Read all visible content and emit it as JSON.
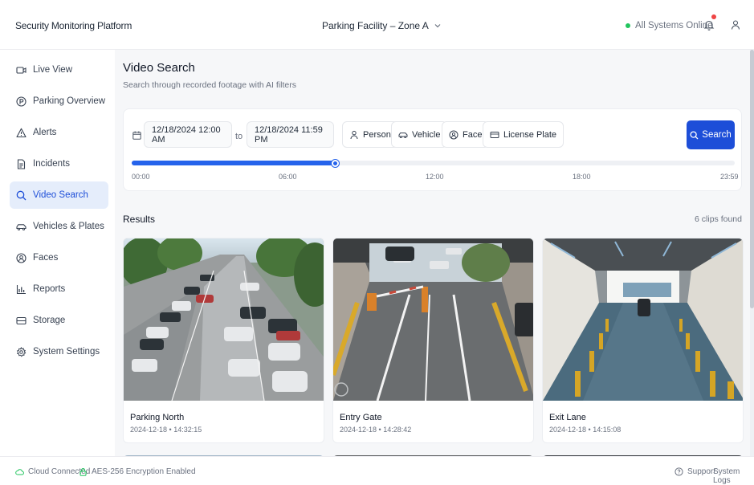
{
  "header": {
    "brand": "Security Monitoring Platform",
    "facility": "Parking Facility – Zone A",
    "status": "All Systems Online",
    "status_color": "#22c55e",
    "notification_color": "#ef4444"
  },
  "sidebar": {
    "items": [
      {
        "label": "Live View",
        "icon": "camera-icon"
      },
      {
        "label": "Parking Overview",
        "icon": "parking-icon"
      },
      {
        "label": "Alerts",
        "icon": "warning-icon"
      },
      {
        "label": "Incidents",
        "icon": "document-icon"
      },
      {
        "label": "Video Search",
        "icon": "search-icon",
        "active": true
      },
      {
        "label": "Vehicles & Plates",
        "icon": "car-icon"
      },
      {
        "label": "Faces",
        "icon": "face-icon"
      },
      {
        "label": "Reports",
        "icon": "chart-icon"
      },
      {
        "label": "Storage",
        "icon": "storage-icon"
      },
      {
        "label": "System Settings",
        "icon": "gear-icon"
      }
    ]
  },
  "page": {
    "title": "Video Search",
    "subtitle": "Search through recorded footage with AI filters"
  },
  "filters": {
    "start": "12/18/2024 12:00 AM",
    "to": "to",
    "end": "12/18/2024 11:59 PM",
    "chips": [
      {
        "label": "Person",
        "icon": "person-icon"
      },
      {
        "label": "Vehicle",
        "icon": "car-icon"
      },
      {
        "label": "Face",
        "icon": "face-icon"
      },
      {
        "label": "License Plate",
        "icon": "plate-icon"
      }
    ],
    "search_label": "Search",
    "accent": "#1d4ed8"
  },
  "timeline": {
    "ticks": [
      "00:00",
      "06:00",
      "12:00",
      "18:00",
      "23:59"
    ],
    "selected_fraction": 0.337
  },
  "results": {
    "title": "Results",
    "count": "6 clips found",
    "clips": [
      {
        "name": "Parking North",
        "time": "2024-12-18 • 14:32:15"
      },
      {
        "name": "Entry Gate",
        "time": "2024-12-18 • 14:28:42"
      },
      {
        "name": "Exit Lane",
        "time": "2024-12-18 • 14:15:08"
      }
    ]
  },
  "footer": {
    "connection": "Cloud Connected",
    "encryption": "AES-256 Encryption Enabled",
    "support": "Support",
    "logs": "System Logs"
  }
}
